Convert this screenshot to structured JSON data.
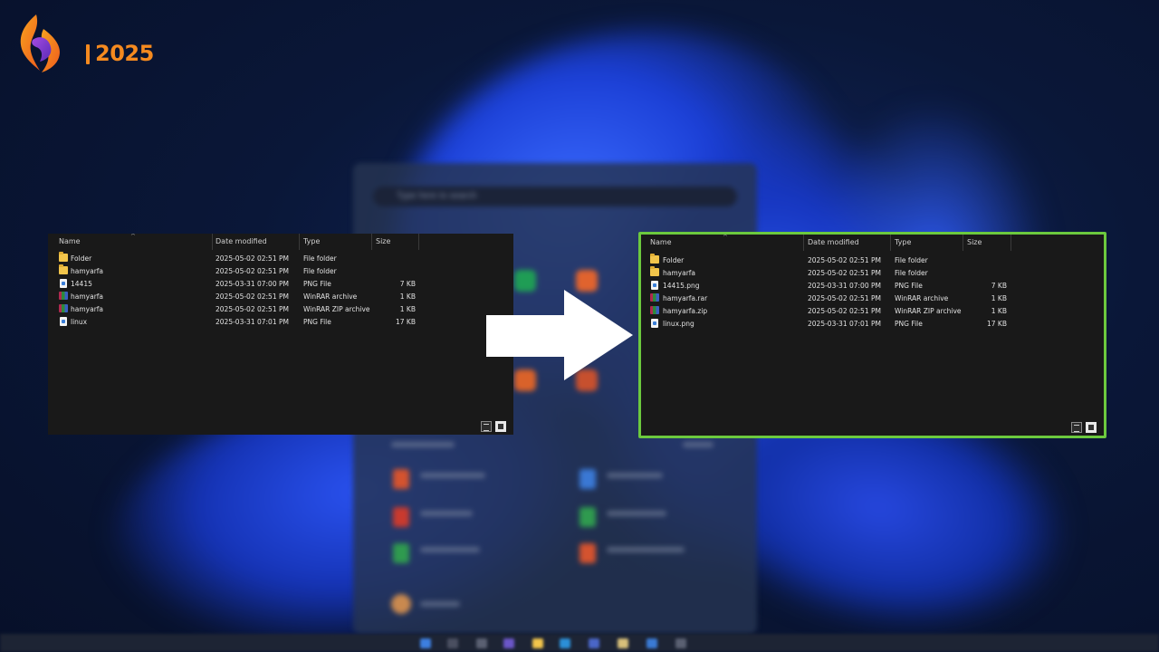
{
  "logo": {
    "year": "2025",
    "brand_colors": [
      "#f58a1f",
      "#8a3bd1"
    ]
  },
  "start_menu": {
    "search_placeholder": "Type here to search",
    "recommended_label": "Recommended",
    "more_label": "More"
  },
  "arrow": {
    "color": "#ffffff"
  },
  "left_pane": {
    "columns": {
      "name": "Name",
      "date": "Date modified",
      "type": "Type",
      "size": "Size"
    },
    "rows": [
      {
        "icon": "folder-icon",
        "name": "Folder",
        "date": "2025-05-02 02:51 PM",
        "type": "File folder",
        "size": ""
      },
      {
        "icon": "folder-icon",
        "name": "hamyarfa",
        "date": "2025-05-02 02:51 PM",
        "type": "File folder",
        "size": ""
      },
      {
        "icon": "png-file-icon",
        "name": "14415",
        "date": "2025-03-31 07:00 PM",
        "type": "PNG File",
        "size": "7 KB"
      },
      {
        "icon": "rar-archive-icon",
        "name": "hamyarfa",
        "date": "2025-05-02 02:51 PM",
        "type": "WinRAR archive",
        "size": "1 KB"
      },
      {
        "icon": "zip-archive-icon",
        "name": "hamyarfa",
        "date": "2025-05-02 02:51 PM",
        "type": "WinRAR ZIP archive",
        "size": "1 KB"
      },
      {
        "icon": "png-file-icon",
        "name": "linux",
        "date": "2025-03-31 07:01 PM",
        "type": "PNG File",
        "size": "17 KB"
      }
    ]
  },
  "right_pane": {
    "highlight_color": "#6cc93e",
    "columns": {
      "name": "Name",
      "date": "Date modified",
      "type": "Type",
      "size": "Size"
    },
    "rows": [
      {
        "icon": "folder-icon",
        "name": "Folder",
        "date": "2025-05-02 02:51 PM",
        "type": "File folder",
        "size": ""
      },
      {
        "icon": "folder-icon",
        "name": "hamyarfa",
        "date": "2025-05-02 02:51 PM",
        "type": "File folder",
        "size": ""
      },
      {
        "icon": "png-file-icon",
        "name": "14415.png",
        "date": "2025-03-31 07:00 PM",
        "type": "PNG File",
        "size": "7 KB"
      },
      {
        "icon": "rar-archive-icon",
        "name": "hamyarfa.rar",
        "date": "2025-05-02 02:51 PM",
        "type": "WinRAR archive",
        "size": "1 KB"
      },
      {
        "icon": "zip-archive-icon",
        "name": "hamyarfa.zip",
        "date": "2025-05-02 02:51 PM",
        "type": "WinRAR ZIP archive",
        "size": "1 KB"
      },
      {
        "icon": "png-file-icon",
        "name": "linux.png",
        "date": "2025-03-31 07:01 PM",
        "type": "PNG File",
        "size": "17 KB"
      }
    ]
  }
}
